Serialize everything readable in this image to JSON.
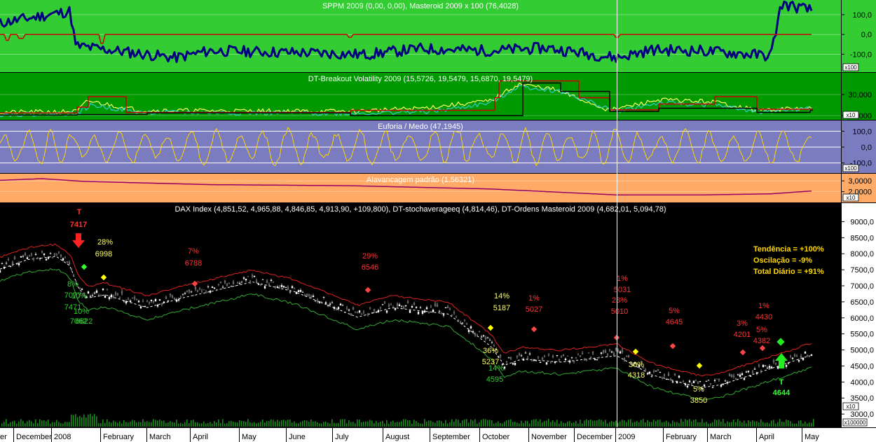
{
  "chart_data": {
    "type": "line",
    "panels": [
      {
        "id": "sppm",
        "title": "SPPM 2009 (0,00, 0,00), Masteroid 2009 x 100 (76,4028)",
        "ticks": [
          "100,0",
          "0,0",
          "-100,0"
        ],
        "tick_values": [
          100,
          0,
          -100
        ],
        "ylim": [
          -180,
          160
        ],
        "scale_badge": "x100",
        "bg": "#33cc33",
        "series": [
          {
            "color": "#000080",
            "stroke": 3,
            "seed": 11,
            "anchors": [
              [
                0,
                58
              ],
              [
                100,
                118
              ],
              [
                108,
                -58
              ],
              [
                250,
                -118
              ],
              [
                300,
                -82
              ],
              [
                430,
                -92
              ],
              [
                520,
                -102
              ],
              [
                600,
                -72
              ],
              [
                700,
                -82
              ],
              [
                780,
                -68
              ],
              [
                880,
                -118
              ],
              [
                930,
                -78
              ],
              [
                1000,
                -82
              ],
              [
                1100,
                -108
              ],
              [
                1108,
                35
              ],
              [
                1115,
                155
              ],
              [
                1160,
                120
              ]
            ],
            "noise": 28
          },
          {
            "color": "#cc0000",
            "stroke": 1.5,
            "seed": 3,
            "anchors": [
              [
                0,
                0
              ],
              [
                1160,
                0
              ]
            ],
            "noise": 0,
            "spikes": [
              [
                10,
                -30
              ],
              [
                30,
                -20
              ],
              [
                145,
                -45
              ],
              [
                500,
                -15
              ],
              [
                880,
                -15
              ]
            ]
          }
        ]
      },
      {
        "id": "breakout",
        "title": "DT-Breakout Volatility 2009 (15,5726, 19,5479, 15,6870, 19,5479)",
        "ticks": [
          "30,000",
          "10,000"
        ],
        "tick_values": [
          30000,
          10000
        ],
        "ylim": [
          8000,
          48000
        ],
        "scale_badge": "x10",
        "bg": "#009900",
        "series": [
          {
            "color": "#ffff66",
            "stroke": 1.2,
            "seed": 21,
            "anchors": [
              [
                0,
                13000
              ],
              [
                110,
                14000
              ],
              [
                125,
                24000
              ],
              [
                200,
                15000
              ],
              [
                500,
                14000
              ],
              [
                600,
                17000
              ],
              [
                700,
                24000
              ],
              [
                740,
                40000
              ],
              [
                790,
                35000
              ],
              [
                870,
                15000
              ],
              [
                940,
                25000
              ],
              [
                1020,
                23000
              ],
              [
                1080,
                15000
              ],
              [
                1155,
                17000
              ]
            ],
            "noise": 2200
          },
          {
            "color": "#33cccc",
            "stroke": 1.2,
            "seed": 22,
            "anchors": [
              [
                0,
                11000
              ],
              [
                110,
                12000
              ],
              [
                130,
                20000
              ],
              [
                200,
                13000
              ],
              [
                500,
                12000
              ],
              [
                620,
                14000
              ],
              [
                700,
                22000
              ],
              [
                740,
                38000
              ],
              [
                800,
                33000
              ],
              [
                880,
                14000
              ],
              [
                940,
                22000
              ],
              [
                1020,
                20000
              ],
              [
                1080,
                13500
              ],
              [
                1155,
                16500
              ]
            ],
            "noise": 2200
          },
          {
            "color": "#cc0000",
            "stroke": 1.5,
            "steps": [
              [
                0,
                12500
              ],
              [
                110,
                18000
              ],
              [
                125,
                28000
              ],
              [
                180,
                13000
              ],
              [
                500,
                15000
              ],
              [
                705,
                27000
              ],
              [
                712,
                43000
              ],
              [
                825,
                27000
              ],
              [
                870,
                15500
              ],
              [
                940,
                21000
              ],
              [
                1020,
                28000
              ],
              [
                1080,
                16000
              ],
              [
                1155,
                16000
              ]
            ]
          },
          {
            "color": "#000000",
            "stroke": 1.5,
            "steps": [
              [
                0,
                10500
              ],
              [
                110,
                11000
              ],
              [
                210,
                12500
              ],
              [
                500,
                10000
              ],
              [
                740,
                10000
              ],
              [
                745,
                41000
              ],
              [
                800,
                33000
              ],
              [
                870,
                14000
              ],
              [
                940,
                17000
              ],
              [
                1080,
                13000
              ],
              [
                1155,
                15000
              ]
            ]
          }
        ]
      },
      {
        "id": "euforia",
        "title": "Euforia / Medo (47,1945)",
        "ticks": [
          "100,0",
          "0,0",
          "-100,0"
        ],
        "tick_values": [
          100,
          0,
          -100
        ],
        "ylim": [
          -150,
          150
        ],
        "scale_badge": "x100",
        "bg": "#7b7bc0",
        "series": [
          {
            "color": "#ffd700",
            "stroke": 1,
            "seed": 31,
            "anchors": [
              [
                0,
                0
              ],
              [
                1160,
                0
              ]
            ],
            "noise": 0,
            "osc": 100
          }
        ]
      },
      {
        "id": "alavancagem",
        "title": "Alavancagem padrão (1,56321)",
        "ticks": [
          "3,0000",
          "2,0000"
        ],
        "tick_values": [
          3,
          2
        ],
        "ylim": [
          1.2,
          3.4
        ],
        "scale_badge": "x10",
        "bg": "#ffaa66",
        "series": [
          {
            "color": "#990066",
            "stroke": 1.5,
            "seed": 41,
            "anchors": [
              [
                0,
                3.05
              ],
              [
                60,
                3.2
              ],
              [
                120,
                2.95
              ],
              [
                300,
                2.65
              ],
              [
                500,
                2.55
              ],
              [
                700,
                2.25
              ],
              [
                880,
                1.7
              ],
              [
                1000,
                1.7
              ],
              [
                1100,
                1.8
              ],
              [
                1155,
                2.05
              ]
            ],
            "noise": 0
          }
        ]
      }
    ],
    "main": {
      "title": "DAX Index (4,851,52, 4,965,88, 4,846,85, 4,913,90, +109,800), DT-stochaverageeq (4,814,46), DT-Ordens Masteroid 2009 (4,682,01, 5,094,78)",
      "ticks": [
        "9000,0",
        "8500,0",
        "8000,0",
        "7500,0",
        "7000,0",
        "6500,0",
        "6000,0",
        "5500,0",
        "5000,0",
        "4500,0",
        "4000,0",
        "3500,0",
        "3000,0"
      ],
      "tick_values": [
        9000,
        8500,
        8000,
        7500,
        7000,
        6500,
        6000,
        5500,
        5000,
        4500,
        4000,
        3500,
        3000
      ],
      "ylim": [
        2850,
        9250
      ],
      "scale_badge": "x10",
      "volume_badge": "x100000",
      "price_anchors": [
        [
          0,
          7600
        ],
        [
          40,
          7900
        ],
        [
          80,
          8000
        ],
        [
          100,
          7700
        ],
        [
          112,
          7000
        ],
        [
          125,
          6700
        ],
        [
          150,
          6800
        ],
        [
          210,
          6400
        ],
        [
          260,
          6700
        ],
        [
          360,
          7200
        ],
        [
          420,
          6900
        ],
        [
          510,
          6100
        ],
        [
          560,
          6400
        ],
        [
          640,
          6200
        ],
        [
          700,
          5200
        ],
        [
          720,
          4600
        ],
        [
          745,
          4800
        ],
        [
          800,
          4700
        ],
        [
          880,
          4900
        ],
        [
          930,
          4300
        ],
        [
          1000,
          3900
        ],
        [
          1030,
          4000
        ],
        [
          1100,
          4500
        ],
        [
          1155,
          4900
        ]
      ],
      "summary": {
        "trend": "Tendência = +100%",
        "oscillation": "Oscilação = -9%",
        "daily": "Total Diário = +91%"
      },
      "annotations": [
        {
          "text": "T",
          "x": 113,
          "y": 306,
          "color": "#ff3333",
          "bold": true
        },
        {
          "text": "7417",
          "x": 112,
          "y": 324,
          "color": "#ff3333",
          "bold": true
        },
        {
          "text": "28%",
          "x": 150,
          "y": 349,
          "color": "#ffff66"
        },
        {
          "text": "6998",
          "x": 148,
          "y": 366,
          "color": "#ffff66"
        },
        {
          "text": "7%",
          "x": 276,
          "y": 362,
          "color": "#ff3333"
        },
        {
          "text": "6788",
          "x": 276,
          "y": 379,
          "color": "#ff3333"
        },
        {
          "text": "29%",
          "x": 528,
          "y": 369,
          "color": "#ff3333"
        },
        {
          "text": "6546",
          "x": 528,
          "y": 385,
          "color": "#ff3333"
        },
        {
          "text": "8%",
          "x": 104,
          "y": 409,
          "color": "#33cc33"
        },
        {
          "text": "7077",
          "x": 104,
          "y": 425,
          "color": "#33cc33"
        },
        {
          "text": "10%",
          "x": 113,
          "y": 426,
          "color": "#33cc33"
        },
        {
          "text": "7471",
          "x": 104,
          "y": 442,
          "color": "#33cc33"
        },
        {
          "text": "10%",
          "x": 116,
          "y": 448,
          "color": "#33cc33"
        },
        {
          "text": "7062",
          "x": 112,
          "y": 462,
          "color": "#33cc33"
        },
        {
          "text": "6622",
          "x": 120,
          "y": 462,
          "color": "#33cc33"
        },
        {
          "text": "14%",
          "x": 716,
          "y": 426,
          "color": "#ffff66"
        },
        {
          "text": "5187",
          "x": 716,
          "y": 443,
          "color": "#ffff66"
        },
        {
          "text": "1%",
          "x": 762,
          "y": 429,
          "color": "#ff3333"
        },
        {
          "text": "5027",
          "x": 762,
          "y": 445,
          "color": "#ff3333"
        },
        {
          "text": "1%",
          "x": 888,
          "y": 401,
          "color": "#ff3333"
        },
        {
          "text": "5031",
          "x": 888,
          "y": 417,
          "color": "#ff3333"
        },
        {
          "text": "28%",
          "x": 884,
          "y": 432,
          "color": "#ff3333"
        },
        {
          "text": "5010",
          "x": 884,
          "y": 448,
          "color": "#ff3333"
        },
        {
          "text": "5%",
          "x": 962,
          "y": 447,
          "color": "#ff3333"
        },
        {
          "text": "4645",
          "x": 962,
          "y": 463,
          "color": "#ff3333"
        },
        {
          "text": "1%",
          "x": 1090,
          "y": 440,
          "color": "#ff3333"
        },
        {
          "text": "4430",
          "x": 1090,
          "y": 456,
          "color": "#ff3333"
        },
        {
          "text": "3%",
          "x": 1059,
          "y": 465,
          "color": "#ff3333"
        },
        {
          "text": "4201",
          "x": 1059,
          "y": 481,
          "color": "#ff3333"
        },
        {
          "text": "5%",
          "x": 1087,
          "y": 474,
          "color": "#ff3333"
        },
        {
          "text": "4382",
          "x": 1087,
          "y": 490,
          "color": "#ff3333"
        },
        {
          "text": "36%",
          "x": 700,
          "y": 504,
          "color": "#ffff66"
        },
        {
          "text": "5237",
          "x": 700,
          "y": 520,
          "color": "#ffff66"
        },
        {
          "text": "14%",
          "x": 708,
          "y": 529,
          "color": "#33cc33"
        },
        {
          "text": "4595",
          "x": 706,
          "y": 545,
          "color": "#33cc33"
        },
        {
          "text": "30%",
          "x": 908,
          "y": 524,
          "color": "#ffff66"
        },
        {
          "text": "4318",
          "x": 908,
          "y": 539,
          "color": "#ffff66"
        },
        {
          "text": "5%",
          "x": 997,
          "y": 559,
          "color": "#ffff66"
        },
        {
          "text": "3850",
          "x": 997,
          "y": 575,
          "color": "#ffff66"
        },
        {
          "text": "T",
          "x": 1115,
          "y": 549,
          "color": "#33ff33",
          "bold": true
        },
        {
          "text": "4644",
          "x": 1115,
          "y": 564,
          "color": "#33ff33",
          "bold": true
        }
      ],
      "signals": [
        {
          "type": "down-arrow",
          "x": 112,
          "y": 343,
          "color": "#ff2222"
        },
        {
          "type": "up-arrow",
          "x": 1115,
          "y": 515,
          "color": "#22ee22"
        }
      ]
    },
    "x_axis": {
      "labels": [
        "er",
        "December",
        "2008",
        "February",
        "March",
        "April",
        "May",
        "June",
        "July",
        "August",
        "September",
        "October",
        "November",
        "December",
        "2009",
        "February",
        "March",
        "April",
        "May"
      ],
      "label_x": [
        0,
        23,
        77,
        147,
        213,
        275,
        345,
        412,
        478,
        550,
        617,
        688,
        758,
        823,
        882,
        950,
        1013,
        1083,
        1148
      ]
    }
  }
}
